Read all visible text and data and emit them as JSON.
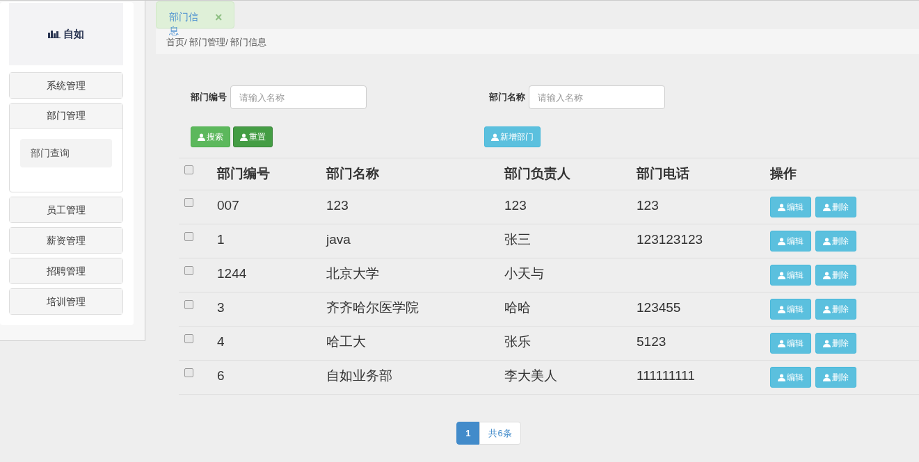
{
  "logo": {
    "text": "自如"
  },
  "sidebar": {
    "items": [
      {
        "label": "系统管理",
        "expanded": false
      },
      {
        "label": "部门管理",
        "expanded": true,
        "children": [
          {
            "label": "部门查询",
            "selected": true
          }
        ]
      },
      {
        "label": "员工管理",
        "expanded": false
      },
      {
        "label": "薪资管理",
        "expanded": false
      },
      {
        "label": "招聘管理",
        "expanded": false
      },
      {
        "label": "培训管理",
        "expanded": false
      }
    ]
  },
  "tabs": [
    {
      "label": "部门信息",
      "close": "×",
      "selected": true
    }
  ],
  "breadcrumb": "首页/ 部门管理/ 部门信息",
  "filters": [
    {
      "label": "部门编号",
      "placeholder": "请输入名称"
    },
    {
      "label": "部门名称",
      "placeholder": "请输入名称"
    }
  ],
  "buttons": [
    {
      "label": "搜索",
      "kind": "success"
    },
    {
      "label": "重置",
      "kind": "dark"
    },
    {
      "label": "新增部门",
      "kind": "info"
    }
  ],
  "table": {
    "select_all": false,
    "columns": [
      "部门编号",
      "部门名称",
      "部门负责人",
      "部门电话",
      "操作"
    ],
    "rows": [
      {
        "checked": false,
        "cells": [
          "007",
          "123",
          "123",
          "123"
        ],
        "actions": [
          "编辑",
          "删除"
        ]
      },
      {
        "checked": false,
        "cells": [
          "1",
          "java",
          "张三",
          "123123123"
        ],
        "actions": [
          "编辑",
          "删除"
        ]
      },
      {
        "checked": false,
        "cells": [
          "1244",
          "北京大学",
          "小天与"
        ],
        "actions": [
          "编辑",
          "删除"
        ]
      },
      {
        "checked": false,
        "cells": [
          "3",
          "齐齐哈尔医学院",
          "哈哈",
          "123455"
        ],
        "actions": [
          "编辑",
          "删除"
        ]
      },
      {
        "checked": false,
        "cells": [
          "4",
          "哈工大",
          "张乐",
          "5123"
        ],
        "actions": [
          "编辑",
          "删除"
        ]
      },
      {
        "checked": false,
        "cells": [
          "6",
          "自如业务部",
          "李大美人",
          "111111111"
        ],
        "actions": [
          "编辑",
          "删除"
        ]
      }
    ]
  },
  "pagination": {
    "pages": [
      {
        "label": "1",
        "selected": true
      }
    ],
    "total": "共6条"
  }
}
